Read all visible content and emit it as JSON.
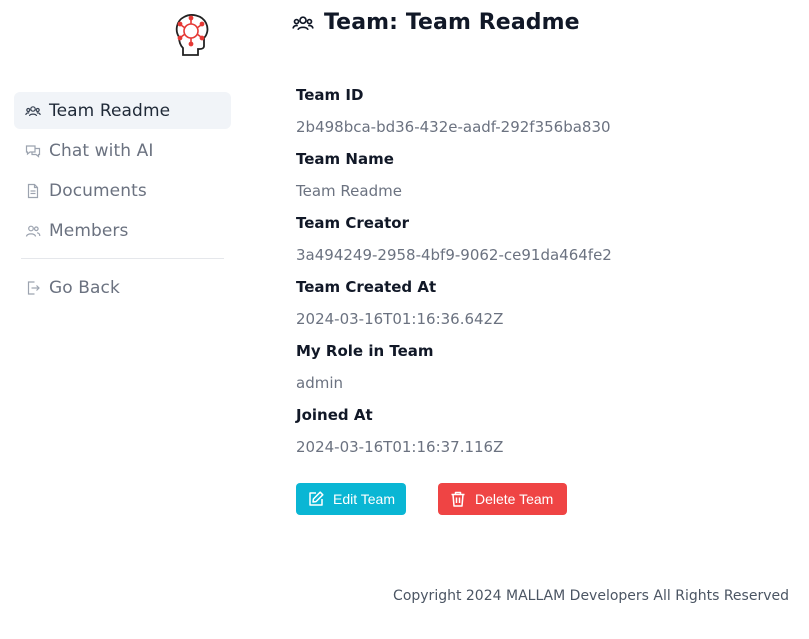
{
  "brand": {
    "logo_icon": "ai-head-circuit-icon",
    "accent": "#e53935"
  },
  "sidebar": {
    "items": [
      {
        "label": "Team Readme",
        "icon": "team-icon",
        "active": true
      },
      {
        "label": "Chat with AI",
        "icon": "chat-icon",
        "active": false
      },
      {
        "label": "Documents",
        "icon": "document-icon",
        "active": false
      },
      {
        "label": "Members",
        "icon": "members-icon",
        "active": false
      }
    ],
    "back": {
      "label": "Go Back",
      "icon": "exit-icon"
    }
  },
  "header": {
    "title": "Team: Team Readme",
    "icon": "team-icon"
  },
  "details": {
    "team_id": {
      "label": "Team ID",
      "value": "2b498bca-bd36-432e-aadf-292f356ba830"
    },
    "team_name": {
      "label": "Team Name",
      "value": "Team Readme"
    },
    "team_creator": {
      "label": "Team Creator",
      "value": "3a494249-2958-4bf9-9062-ce91da464fe2"
    },
    "created_at": {
      "label": "Team Created At",
      "value": "2024-03-16T01:16:36.642Z"
    },
    "role": {
      "label": "My Role in Team",
      "value": "admin"
    },
    "joined_at": {
      "label": "Joined At",
      "value": "2024-03-16T01:16:37.116Z"
    }
  },
  "actions": {
    "edit_label": "Edit Team",
    "delete_label": "Delete Team",
    "edit_color": "#0ab6d4",
    "delete_color": "#ef4444"
  },
  "footer": {
    "text": "Copyright 2024 MALLAM Developers All Rights Reserved"
  }
}
